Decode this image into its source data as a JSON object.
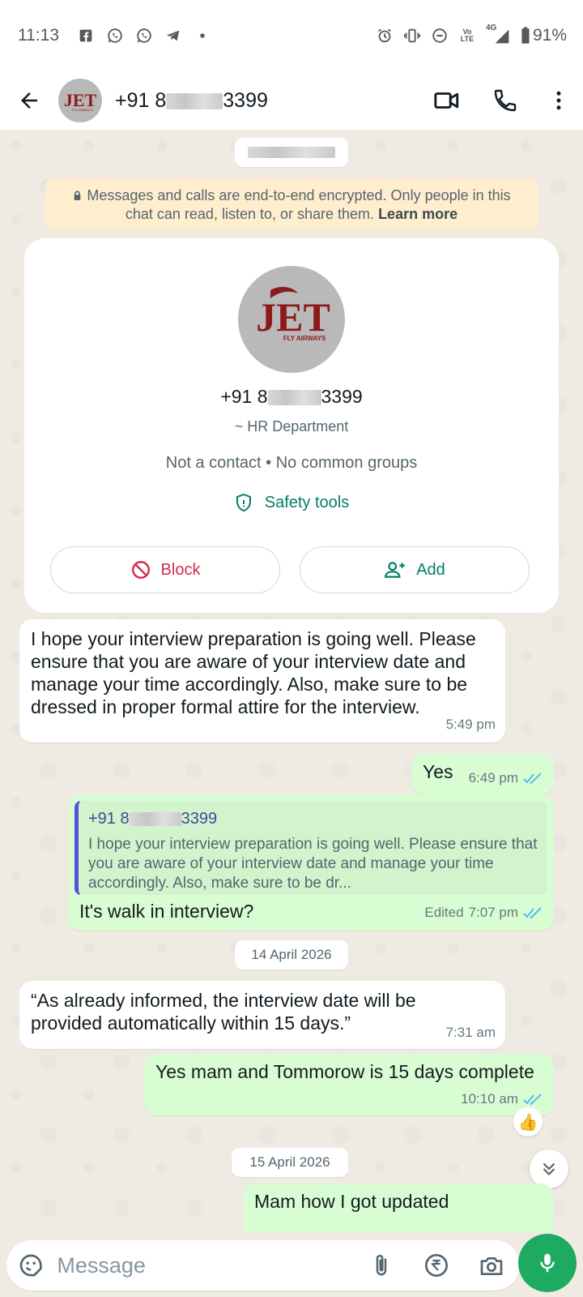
{
  "status_bar": {
    "time": "11:13",
    "battery_pct": "91%",
    "network": "4G",
    "volte": "Vo LTE",
    "left_icons": [
      "facebook-icon",
      "whatsapp-icon",
      "whatsapp-icon",
      "telegram-icon",
      "dot-icon"
    ],
    "right_icons": [
      "alarm-icon",
      "vibrate-icon",
      "dnd-icon",
      "volte-icon",
      "signal-icon",
      "battery-icon"
    ]
  },
  "header": {
    "name_prefix": "+91 8",
    "name_suffix": "3399"
  },
  "chat": {
    "top_date_pill": "",
    "encryption_notice": "Messages and calls are end-to-end encrypted. Only people in this chat can read, listen to, or share them.",
    "learn_more": "Learn more",
    "contact_card": {
      "name_prefix": "+91 8",
      "name_suffix": "3399",
      "subtitle": "~ HR Department",
      "info": "Not a contact • No common groups",
      "safety_tools": "Safety tools",
      "block_label": "Block",
      "add_label": "Add"
    },
    "messages": [
      {
        "direction": "in",
        "text": "I hope your interview preparation is going well. Please ensure that you are aware of your interview date and manage your time accordingly. Also, make sure to be dressed in proper formal attire for the interview.",
        "time": "5:49 pm"
      },
      {
        "direction": "out",
        "text": "Yes",
        "time": "6:49 pm"
      },
      {
        "direction": "out",
        "quote_name_prefix": "+91 8",
        "quote_name_suffix": "3399",
        "quote_text": "I hope your interview preparation is going well. Please ensure that you are aware of your interview date and manage your time accordingly. Also, make sure to be dr...",
        "text": "It's walk in interview?",
        "edited": "Edited",
        "time": "7:07 pm"
      },
      {
        "direction": "in",
        "text": "“As already informed, the interview date will be provided automatically within 15 days.”",
        "time": "7:31 am"
      },
      {
        "direction": "out",
        "text": "Yes mam and Tommorow is 15 days complete",
        "time": "10:10 am",
        "reaction": "👍"
      },
      {
        "direction": "out",
        "text": "Mam how I got updated",
        "time": ""
      }
    ],
    "date_pills": [
      "14 April 2026",
      "15 April 2026"
    ]
  },
  "composer": {
    "placeholder": "Message"
  },
  "colors": {
    "accent": "#008069",
    "outgoing_bubble": "#d9fdd3",
    "chat_background": "#efeae2",
    "block_red": "#d42a4f",
    "mic_green": "#1daa61",
    "read_tick": "#53bdeb"
  }
}
